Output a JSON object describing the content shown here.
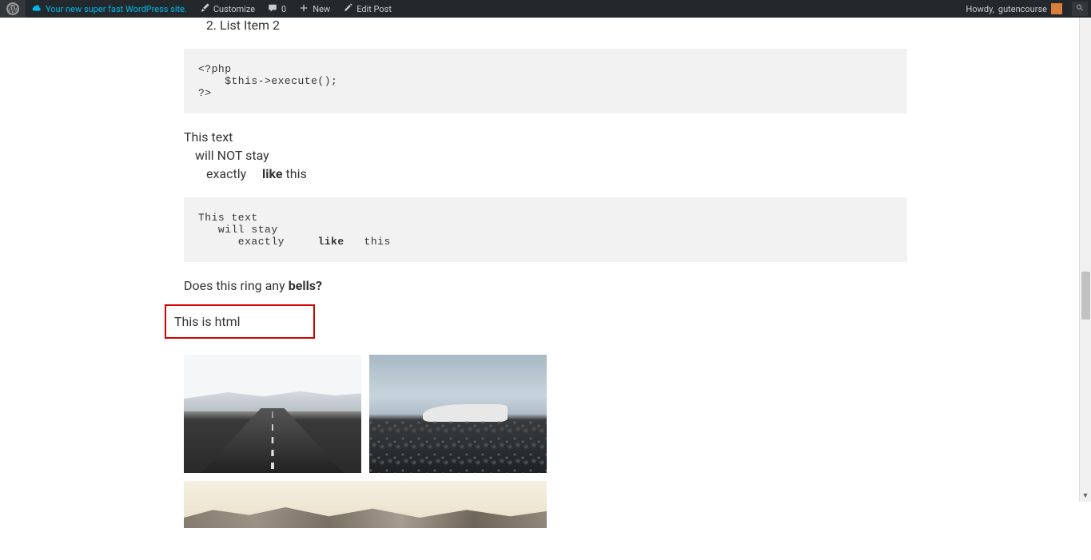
{
  "admin_bar": {
    "site_name": "Your new super fast WordPress site.",
    "customize": "Customize",
    "comments_count": "0",
    "new_label": "New",
    "edit_post": "Edit Post",
    "howdy_prefix": "Howdy, ",
    "username": "gutencourse"
  },
  "content": {
    "list": {
      "start": 2,
      "items": [
        "List Item 2"
      ]
    },
    "code1_line1": "<?php",
    "code1_line2": "    $this->execute();",
    "code1_line3": "?>",
    "paragraph": {
      "line1": "This text",
      "line2": "will NOT stay",
      "line3_a": "exactly",
      "line3_b": "like",
      "line3_c": " this"
    },
    "code2_line1": "This text",
    "code2_line2": "   will stay",
    "code2_line3a": "      exactly     ",
    "code2_line3b": "like",
    "code2_line3c": "   this",
    "question_a": "Does this ring any ",
    "question_b": "bells?",
    "html_box": "This is html"
  },
  "gallery": {
    "img1": "snowy-road-photo",
    "img2": "crashed-plane-beach-photo",
    "img3": "hazy-mountains-panorama-photo"
  }
}
